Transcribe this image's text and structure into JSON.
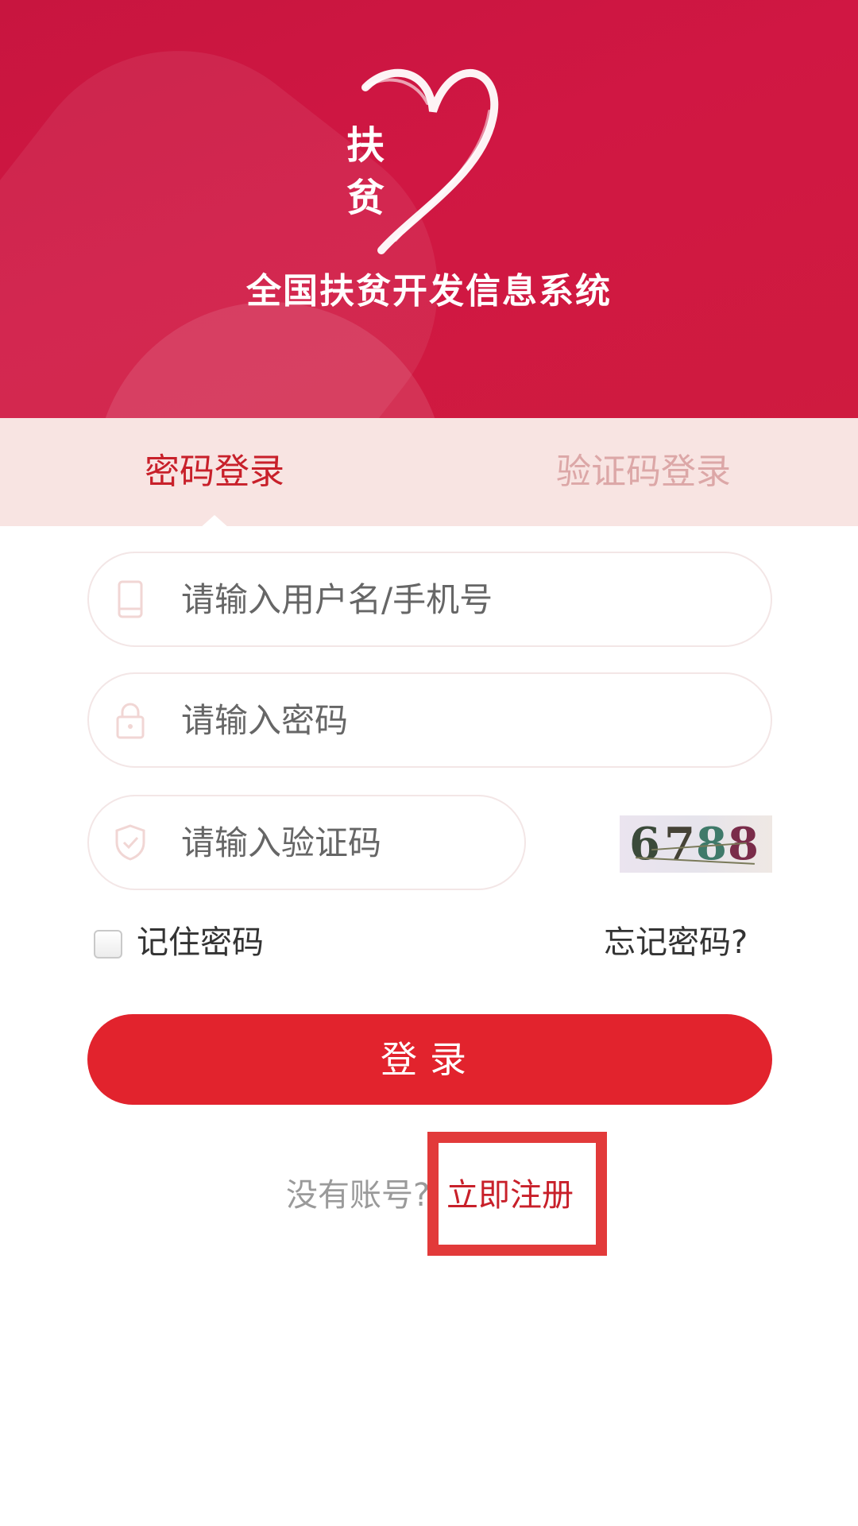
{
  "header": {
    "logo_text_1": "扶",
    "logo_text_2": "贫",
    "title": "全国扶贫开发信息系统"
  },
  "tabs": {
    "password_login": "密码登录",
    "code_login": "验证码登录"
  },
  "form": {
    "username_placeholder": "请输入用户名/手机号",
    "password_placeholder": "请输入密码",
    "captcha_placeholder": "请输入验证码",
    "captcha_value": "6788",
    "remember_label": "记住密码",
    "remember_checked": false,
    "forgot_link": "忘记密码?",
    "login_button": "登录"
  },
  "register": {
    "prompt": "没有账号?",
    "link": "立即注册"
  },
  "colors": {
    "brand_red": "#cc1744",
    "button_red": "#e2232d",
    "tab_bg": "#f8e4e2",
    "active_tab": "#c8202a",
    "inactive_tab": "#dca7a7",
    "highlight_box": "#e23a3a"
  },
  "icons": {
    "username": "phone-icon",
    "password": "lock-icon",
    "captcha": "shield-check-icon"
  }
}
